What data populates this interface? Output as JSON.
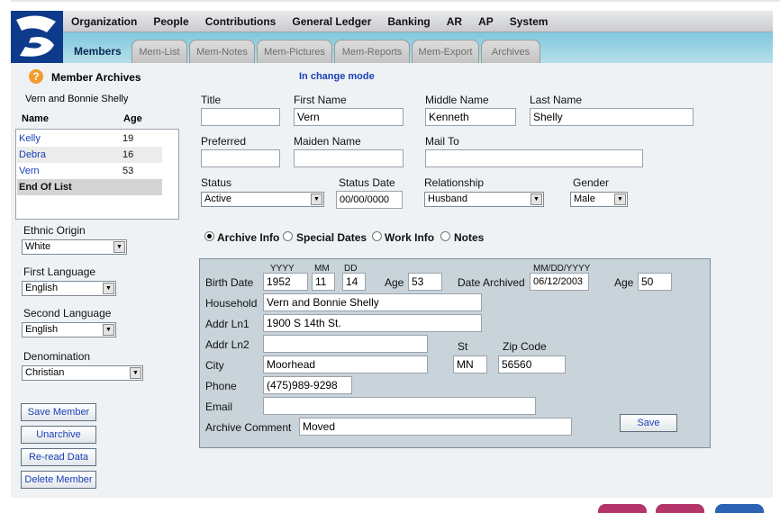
{
  "menu": [
    "Organization",
    "People",
    "Contributions",
    "General Ledger",
    "Banking",
    "AR",
    "AP",
    "System"
  ],
  "section_title": "Members",
  "tabs": [
    "Mem-List",
    "Mem-Notes",
    "Mem-Pictures",
    "Mem-Reports",
    "Mem-Export",
    "Archives"
  ],
  "page": {
    "help_glyph": "?",
    "title": "Member Archives",
    "mode": "In change mode",
    "household_name": "Vern and Bonnie Shelly"
  },
  "member_list": {
    "col_name": "Name",
    "col_age": "Age",
    "rows": [
      {
        "name": "Kelly",
        "age": "19"
      },
      {
        "name": "Debra",
        "age": "16"
      },
      {
        "name": "Vern",
        "age": "53"
      }
    ],
    "end": "End Of List"
  },
  "left_fields": {
    "ethnic_label": "Ethnic Origin",
    "ethnic_value": "White",
    "first_lang_label": "First Language",
    "first_lang_value": "English",
    "second_lang_label": "Second Language",
    "second_lang_value": "English",
    "denomination_label": "Denomination",
    "denomination_value": "Christian"
  },
  "buttons": {
    "save_member": "Save Member",
    "unarchive": "Unarchive",
    "reread": "Re-read Data",
    "delete_member": "Delete Member",
    "save": "Save"
  },
  "form": {
    "title_label": "Title",
    "title_value": "",
    "first_label": "First Name",
    "first_value": "Vern",
    "middle_label": "Middle Name",
    "middle_value": "Kenneth",
    "last_label": "Last Name",
    "last_value": "Shelly",
    "preferred_label": "Preferred",
    "preferred_value": "",
    "maiden_label": "Maiden Name",
    "maiden_value": "",
    "mailto_label": "Mail To",
    "mailto_value": "",
    "status_label": "Status",
    "status_value": "Active",
    "status_date_label": "Status Date",
    "status_date_value": "00/00/0000",
    "relationship_label": "Relationship",
    "relationship_value": "Husband",
    "gender_label": "Gender",
    "gender_value": "Male"
  },
  "radio_tabs": [
    {
      "label": "Archive Info",
      "selected": true
    },
    {
      "label": "Special Dates",
      "selected": false
    },
    {
      "label": "Work Info",
      "selected": false
    },
    {
      "label": "Notes",
      "selected": false
    }
  ],
  "archive": {
    "yyyy_hint": "YYYY",
    "mm_hint": "MM",
    "dd_hint": "DD",
    "date_hint": "MM/DD/YYYY",
    "birth_label": "Birth Date",
    "birth_year": "1952",
    "birth_month": "11",
    "birth_day": "14",
    "age_label": "Age",
    "age_value": "53",
    "archived_label": "Date Archived",
    "archived_value": "06/12/2003",
    "age2_label": "Age",
    "age2_value": "50",
    "household_label": "Household",
    "household_value": "Vern and Bonnie Shelly",
    "addr1_label": "Addr Ln1",
    "addr1_value": "1900 S 14th St.",
    "addr2_label": "Addr Ln2",
    "addr2_value": "",
    "st_label": "St",
    "zip_label": "Zip Code",
    "city_label": "City",
    "city_value": "Moorhead",
    "st_value": "MN",
    "zip_value": "56560",
    "phone_label": "Phone",
    "phone_value": "(475)989-9298",
    "email_label": "Email",
    "email_value": "",
    "comment_label": "Archive Comment",
    "comment_value": "Moved"
  },
  "colors": {
    "brand_blue": "#0d3a8a",
    "link_blue": "#1a3fb8",
    "tab_bar": "#7fc8de",
    "panel": "#c8d3da",
    "help_orange": "#f39c2b"
  }
}
